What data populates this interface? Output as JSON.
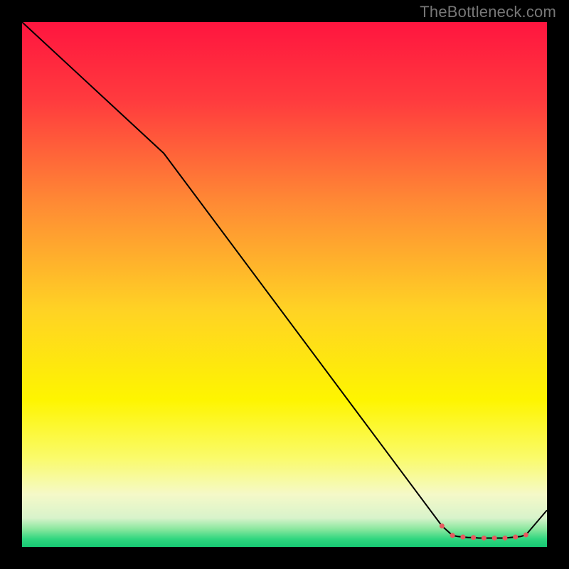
{
  "watermark": "TheBottleneck.com",
  "chart_data": {
    "type": "line",
    "title": "",
    "xlabel": "",
    "ylabel": "",
    "xlim": [
      0,
      100
    ],
    "ylim": [
      0,
      100
    ],
    "grid": false,
    "series": [
      {
        "name": "curve",
        "x": [
          0,
          27,
          80,
          82,
          83,
          84,
          85,
          86,
          87,
          88,
          89,
          90,
          91,
          92,
          93,
          94,
          95,
          96,
          100
        ],
        "y": [
          100,
          75,
          4,
          2.2,
          2.0,
          1.9,
          1.8,
          1.8,
          1.7,
          1.7,
          1.7,
          1.7,
          1.7,
          1.7,
          1.8,
          1.9,
          2.0,
          2.3,
          7
        ],
        "color": "#000000",
        "width": 2
      }
    ],
    "markers": [
      {
        "x": 80,
        "y": 4.0,
        "size": 7,
        "color": "#e65a5f"
      },
      {
        "x": 82,
        "y": 2.2,
        "size": 7,
        "color": "#e65a5f"
      },
      {
        "x": 84,
        "y": 1.9,
        "size": 7,
        "color": "#e65a5f"
      },
      {
        "x": 86,
        "y": 1.8,
        "size": 7,
        "color": "#e65a5f"
      },
      {
        "x": 88,
        "y": 1.7,
        "size": 7,
        "color": "#e65a5f"
      },
      {
        "x": 90,
        "y": 1.7,
        "size": 7,
        "color": "#e65a5f"
      },
      {
        "x": 92,
        "y": 1.7,
        "size": 7,
        "color": "#e65a5f"
      },
      {
        "x": 94,
        "y": 1.9,
        "size": 7,
        "color": "#e65a5f"
      },
      {
        "x": 96,
        "y": 2.3,
        "size": 7,
        "color": "#e65a5f"
      }
    ],
    "background_gradient": {
      "type": "vertical",
      "stops": [
        {
          "pos": 0.0,
          "color": "#ff153f"
        },
        {
          "pos": 0.15,
          "color": "#ff3b3e"
        },
        {
          "pos": 0.35,
          "color": "#ff8c34"
        },
        {
          "pos": 0.55,
          "color": "#ffd324"
        },
        {
          "pos": 0.72,
          "color": "#fef500"
        },
        {
          "pos": 0.83,
          "color": "#fafb6a"
        },
        {
          "pos": 0.9,
          "color": "#f5f9c8"
        },
        {
          "pos": 0.945,
          "color": "#d8f3cb"
        },
        {
          "pos": 0.965,
          "color": "#8ee8a0"
        },
        {
          "pos": 0.985,
          "color": "#2fd67f"
        },
        {
          "pos": 1.0,
          "color": "#17c873"
        }
      ]
    }
  }
}
